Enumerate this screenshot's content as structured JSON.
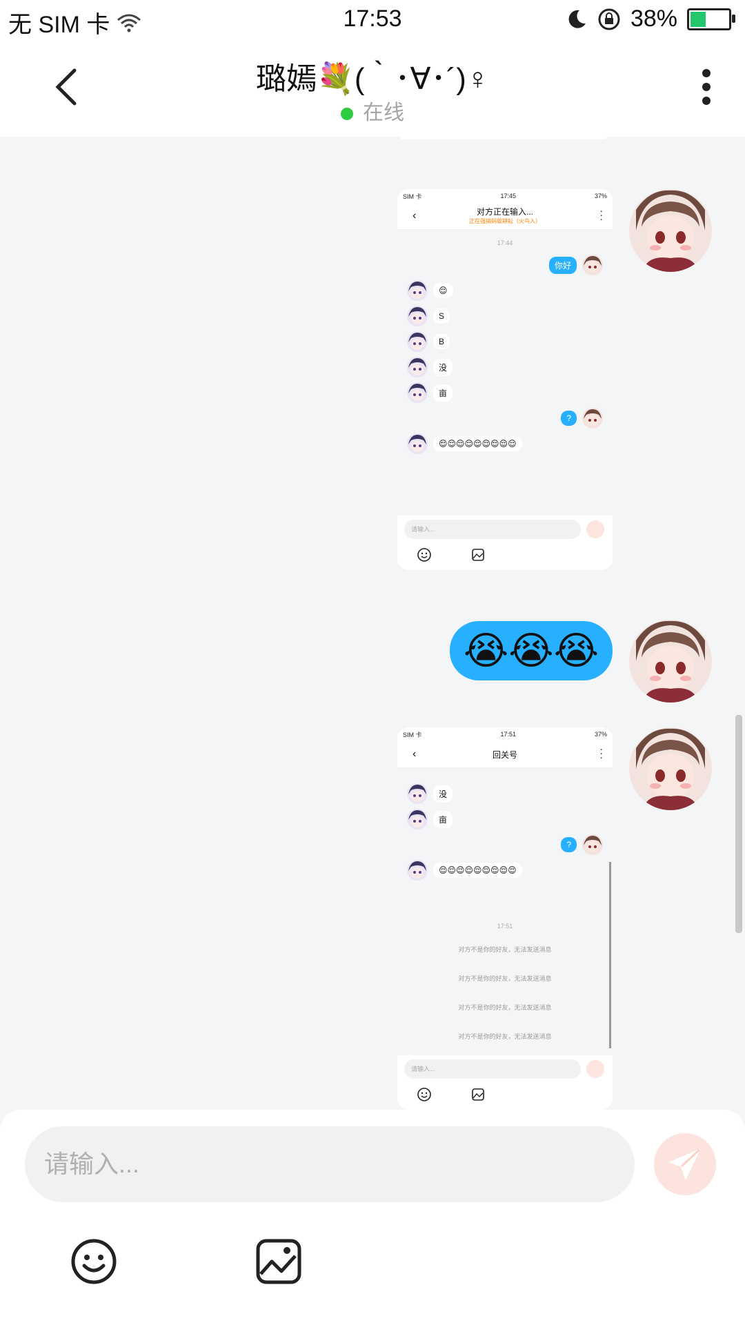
{
  "status_bar": {
    "carrier": "无 SIM 卡",
    "time": "17:53",
    "battery": "38%",
    "battery_level": 0.38,
    "icons": [
      "wifi-icon",
      "moon-icon",
      "rotation-lock-icon",
      "battery-icon"
    ]
  },
  "header": {
    "title": "璐嫣💐(｀･∀･´)♀",
    "status": "在线",
    "online_color": "#2ecc40"
  },
  "screenshot1": {
    "status_left": "SIM 卡",
    "status_time": "17:45",
    "status_right": "37%",
    "title": "对方正在输入...",
    "subtitle": "正在强搞蚂蚁耕耘（火鸟入）",
    "time": "17:44",
    "messages": [
      {
        "side": "right",
        "text": "你好"
      },
      {
        "side": "left",
        "text": "😌"
      },
      {
        "side": "left",
        "text": "S"
      },
      {
        "side": "left",
        "text": "B"
      },
      {
        "side": "left",
        "text": "没"
      },
      {
        "side": "left",
        "text": "亩"
      },
      {
        "side": "right",
        "text": "?"
      },
      {
        "side": "left",
        "text": "😌😌😌😌😌😌😌😌😌"
      }
    ],
    "input_placeholder": "请输入..."
  },
  "big_message": {
    "text": "😭😭😭"
  },
  "screenshot2": {
    "status_left": "SIM 卡",
    "status_time": "17:51",
    "status_right": "37%",
    "title": "回关号",
    "messages": [
      {
        "side": "left",
        "text": "没"
      },
      {
        "side": "left",
        "text": "亩"
      },
      {
        "side": "right",
        "text": "?"
      },
      {
        "side": "left",
        "text": "😌😌😌😌😌😌😌😌😌"
      }
    ],
    "time": "17:51",
    "system_messages": [
      "对方不是你的好友，无法发送消息",
      "对方不是你的好友，无法发送消息",
      "对方不是你的好友，无法发送消息",
      "对方不是你的好友，无法发送消息"
    ],
    "input_placeholder": "请输入..."
  },
  "bottom": {
    "input_placeholder": "请输入...",
    "tools": [
      "emoji-icon",
      "image-icon"
    ],
    "send_icon": "send-icon"
  },
  "colors": {
    "bubble_blue": "#27b0ff",
    "background": "#f4f5f7",
    "send_button": "#fde3dd"
  }
}
